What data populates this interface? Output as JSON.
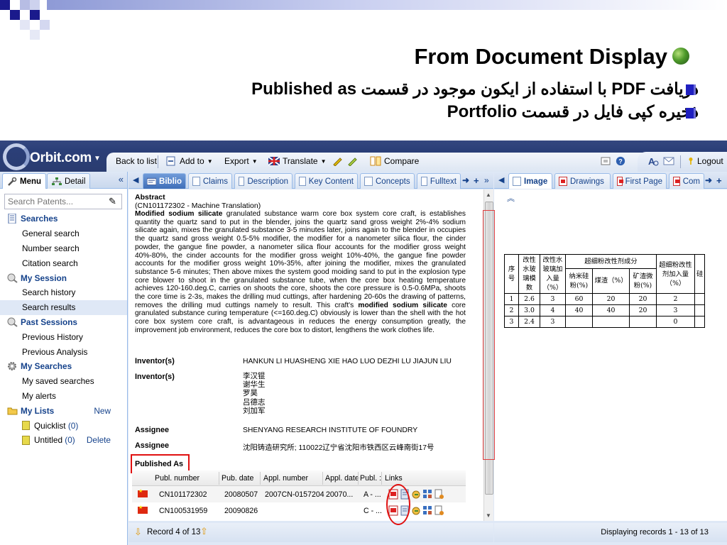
{
  "slide": {
    "title": "From Document Display",
    "bullets": [
      {
        "pre": "دریافت ",
        "en": "PDF",
        "mid": " با استفاده از ایکون موجود در قسمت ",
        "en2": "Published as"
      },
      {
        "pre": "ذخیره کپی فایل در قسمت ",
        "en": "Portfolio",
        "mid": "",
        "en2": ""
      }
    ]
  },
  "app": {
    "logo": "Orbit.com",
    "toolbar": {
      "back": "Back to list",
      "add_to": "Add to",
      "export": "Export",
      "translate": "Translate",
      "compare": "Compare",
      "logout": "Logout"
    },
    "left_tabs": [
      "Menu",
      "Detail"
    ],
    "search_placeholder": "Search Patents...",
    "nav": {
      "searches": "Searches",
      "general": "General search",
      "number": "Number search",
      "citation": "Citation search",
      "session": "My Session",
      "history": "Search history",
      "results": "Search results",
      "past": "Past Sessions",
      "prev_history": "Previous History",
      "prev_analysis": "Previous Analysis",
      "my_searches": "My Searches",
      "saved": "My saved searches",
      "alerts": "My alerts",
      "lists": "My Lists",
      "new": "New",
      "quicklist": "Quicklist",
      "quicklist_count": "(0)",
      "untitled": "Untitled",
      "untitled_count": "(0)",
      "delete": "Delete"
    },
    "mid_tabs": [
      "Biblio",
      "Claims",
      "Description",
      "Key Content",
      "Concepts",
      "Fulltext"
    ],
    "right_tabs": [
      "Image",
      "Drawings",
      "First Page",
      "Com"
    ],
    "abstract": {
      "label": "Abstract",
      "sub": "(CN101172302 - Machine Translation)",
      "lead": "Modified sodium silicate",
      "body1": " granulated substance warm core box system core craft, is establishes quantity the quartz sand to put in the blender, joins the quartz sand gross weight 2%-4% sodium silicate again, mixes the granulated substance 3-5 minutes later, joins again to the blender in occupies the quartz sand gross weight 0.5-5% modifier, the modifier for a nanometer silica flour, the cinder powder, the gangue fine powder, a nanometer silica flour accounts for the modifier gross weight 40%-80%, the cinder accounts for the modifier gross weight 10%-40%, the gangue fine powder accounts for the modifier gross weight 10%-35%, after joining the modifier, mixes the granulated substance 5-6 minutes; Then above mixes the system good moiding sand to put in the explosion type core blower to shoot in the granulated substance tube, when the core box heating temperature achieves 120-160.deg.C, carries on shoots the core, shoots the core pressure is 0.5-0.6MPa, shoots the core time is 2-3s, makes the drilling mud cuttings, after hardening 20-60s the drawing of patterns, removes the drilling mud cuttings namely to result. This craft's ",
      "bold2": "modified sodium silicate",
      "body2": " core granulated substance curing temperature (<=160.deg.C) obviously is lower than the shell with the hot core box system core craft, is advantageous in reduces the energy consumption greatly, the improvement job environment, reduces the core box to distort, lengthens the work clothes life."
    },
    "fields": {
      "inventor_label": "Inventor(s)",
      "inventor_en": "HANKUN LI HUASHENG XIE HAO LUO DEZHI LU JIAJUN LIU",
      "inventor_cn": [
        "李汉锟",
        "谢华生",
        "罗昊",
        "吕德志",
        "刘加军"
      ],
      "assignee_label": "Assignee",
      "assignee_en": "SHENYANG RESEARCH INSTITUTE OF FOUNDRY",
      "assignee_cn": "沈阳铸造研究所; 110022辽宁省沈阳市铁西区云峰南街17号",
      "published_as": "Published As"
    },
    "pub_table": {
      "headers": [
        "Publ. number",
        "Pub. date",
        "Appl. number",
        "Appl. date",
        "Publ. :",
        "Links"
      ],
      "rows": [
        {
          "pn": "CN101172302",
          "pd": "20080507",
          "an": "2007CN-0157204",
          "ad": "20070...",
          "pt": "A - ..."
        },
        {
          "pn": "CN100531959",
          "pd": "20090826",
          "an": "",
          "ad": "",
          "pt": "C - ..."
        }
      ]
    },
    "footer": {
      "record": "Record 4 of 13",
      "displaying": "Displaying records 1 - 13 of 13"
    },
    "image_table": {
      "h1": [
        "序号",
        "改性水玻璃模数",
        "改性水玻璃加入量（%）",
        "超细粉改性剂成分",
        "超细粉改性剂加入量（%）",
        "硅"
      ],
      "h2": [
        "纳米硅粉(%)",
        "煤渣（%）",
        "矿渣微粉(%)"
      ],
      "rows": [
        [
          "1",
          "2.6",
          "3",
          "60",
          "20",
          "20",
          "2",
          ""
        ],
        [
          "2",
          "3.0",
          "4",
          "40",
          "40",
          "20",
          "3",
          ""
        ],
        [
          "3",
          "2.4",
          "3",
          "",
          "",
          "",
          "0",
          ""
        ]
      ]
    },
    "colors": {
      "toolbar": "#2a3c70",
      "accent": "#15428b",
      "highlight": "#e01010"
    }
  }
}
